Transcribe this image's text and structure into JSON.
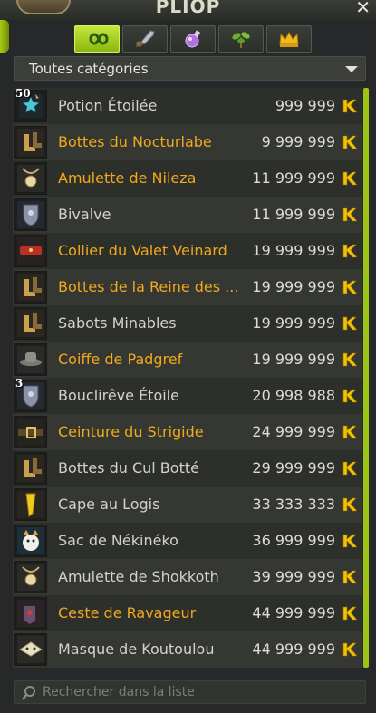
{
  "window": {
    "title": "PLIOP"
  },
  "category_dropdown": {
    "selected": "Toutes catégories"
  },
  "search": {
    "placeholder": "Rechercher dans la liste"
  },
  "tabs": [
    {
      "name": "infinity",
      "active": true
    },
    {
      "name": "sword",
      "active": false
    },
    {
      "name": "potion",
      "active": false
    },
    {
      "name": "plant",
      "active": false
    },
    {
      "name": "crown",
      "active": false
    }
  ],
  "items": [
    {
      "name": "Potion Étoilée",
      "price": "999 999",
      "color": "white",
      "qty": "50",
      "icon": "potion"
    },
    {
      "name": "Bottes du Nocturlabe",
      "price": "9 999 999",
      "color": "gold",
      "qty": "",
      "icon": "boots"
    },
    {
      "name": "Amulette de Nileza",
      "price": "11 999 999",
      "color": "gold",
      "qty": "",
      "icon": "amulet"
    },
    {
      "name": "Bivalve",
      "price": "11 999 999",
      "color": "white",
      "qty": "",
      "icon": "shield"
    },
    {
      "name": "Collier du Valet Veinard",
      "price": "19 999 999",
      "color": "gold",
      "qty": "",
      "icon": "collar"
    },
    {
      "name": "Bottes de la Reine des ...",
      "price": "19 999 999",
      "color": "gold",
      "qty": "",
      "icon": "boots"
    },
    {
      "name": "Sabots Minables",
      "price": "19 999 999",
      "color": "white",
      "qty": "",
      "icon": "boots"
    },
    {
      "name": "Coiffe de Padgref",
      "price": "19 999 999",
      "color": "gold",
      "qty": "",
      "icon": "hat"
    },
    {
      "name": "Bouclirêve Étoile",
      "price": "20 998 988",
      "color": "white",
      "qty": "3",
      "icon": "shield"
    },
    {
      "name": "Ceinture du Strigide",
      "price": "24 999 999",
      "color": "gold",
      "qty": "",
      "icon": "belt"
    },
    {
      "name": "Bottes du Cul Botté",
      "price": "29 999 999",
      "color": "white",
      "qty": "",
      "icon": "boots"
    },
    {
      "name": "Cape au Logis",
      "price": "33 333 333",
      "color": "white",
      "qty": "",
      "icon": "cape"
    },
    {
      "name": "Sac de Nékinéko",
      "price": "36 999 999",
      "color": "white",
      "qty": "",
      "icon": "bag"
    },
    {
      "name": "Amulette de Shokkoth",
      "price": "39 999 999",
      "color": "white",
      "qty": "",
      "icon": "amulet"
    },
    {
      "name": "Ceste de Ravageur",
      "price": "44 999 999",
      "color": "gold",
      "qty": "",
      "icon": "glove"
    },
    {
      "name": "Masque de Koutoulou",
      "price": "44 999 999",
      "color": "white",
      "qty": "",
      "icon": "mask"
    }
  ],
  "colors": {
    "accent": "#9cc414",
    "gold_text": "#f0a81c",
    "kama": "#f2c200"
  }
}
